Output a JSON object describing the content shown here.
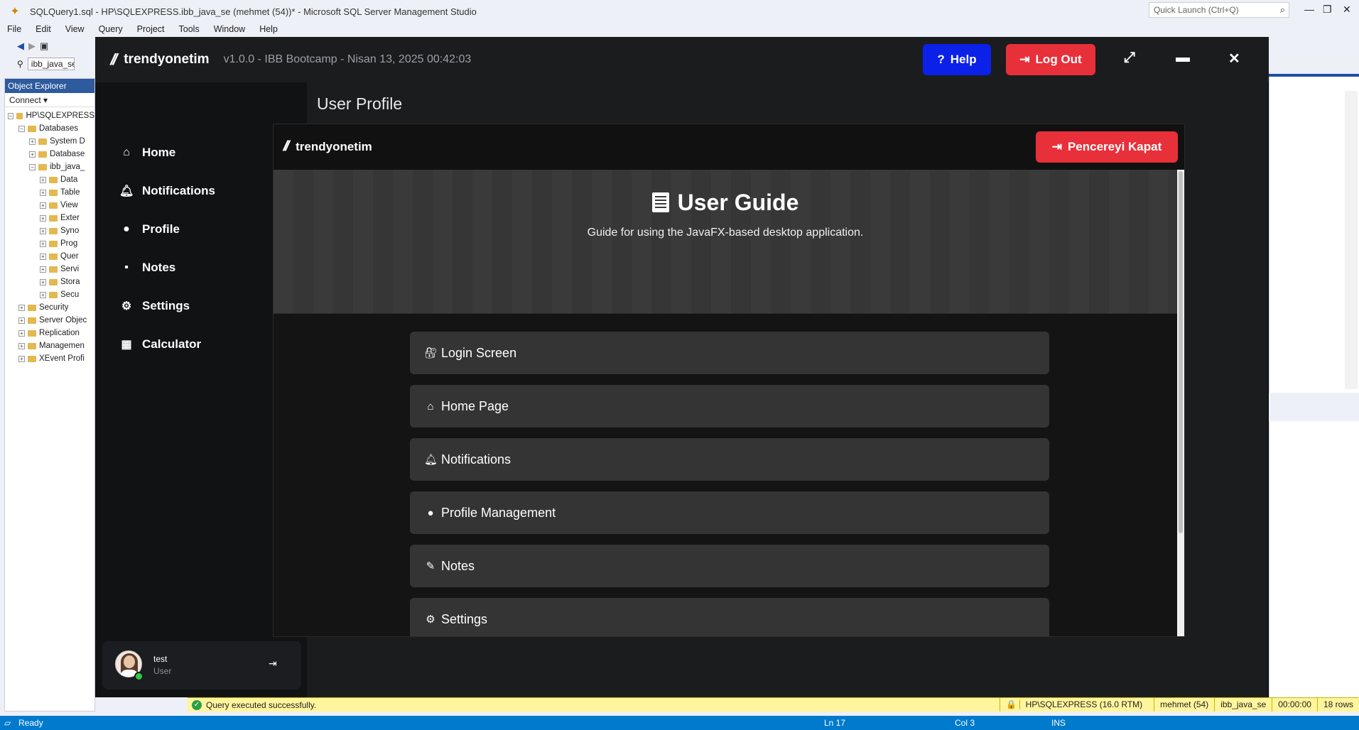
{
  "ssms": {
    "title": "SQLQuery1.sql - HP\\SQLEXPRESS.ibb_java_se (mehmet (54))* - Microsoft SQL Server Management Studio",
    "quick_launch": "Quick Launch (Ctrl+Q)",
    "menu": [
      "File",
      "Edit",
      "View",
      "Query",
      "Project",
      "Tools",
      "Window",
      "Help"
    ],
    "db_combo": "ibb_java_se",
    "object_explorer": {
      "title": "Object Explorer",
      "connect": "Connect ▾",
      "tree": [
        {
          "label": "HP\\SQLEXPRESS",
          "exp": "⊟",
          "indent": 0
        },
        {
          "label": "Databases",
          "exp": "⊟",
          "indent": 1
        },
        {
          "label": "System D",
          "exp": "⊞",
          "indent": 2
        },
        {
          "label": "Database",
          "exp": "⊞",
          "indent": 2
        },
        {
          "label": "ibb_java_",
          "exp": "⊟",
          "indent": 2
        },
        {
          "label": "Data",
          "exp": "⊞",
          "indent": 3
        },
        {
          "label": "Table",
          "exp": "⊞",
          "indent": 3
        },
        {
          "label": "View",
          "exp": "⊞",
          "indent": 3
        },
        {
          "label": "Exter",
          "exp": "⊞",
          "indent": 3
        },
        {
          "label": "Syno",
          "exp": "⊞",
          "indent": 3
        },
        {
          "label": "Prog",
          "exp": "⊞",
          "indent": 3
        },
        {
          "label": "Quer",
          "exp": "⊞",
          "indent": 3
        },
        {
          "label": "Servi",
          "exp": "⊞",
          "indent": 3
        },
        {
          "label": "Stora",
          "exp": "⊞",
          "indent": 3
        },
        {
          "label": "Secu",
          "exp": "⊞",
          "indent": 3
        },
        {
          "label": "Security",
          "exp": "⊞",
          "indent": 1
        },
        {
          "label": "Server Objec",
          "exp": "⊞",
          "indent": 1
        },
        {
          "label": "Replication",
          "exp": "⊞",
          "indent": 1
        },
        {
          "label": "Managemen",
          "exp": "⊞",
          "indent": 1
        },
        {
          "label": "XEvent Profi",
          "exp": "⊞",
          "indent": 1
        }
      ]
    },
    "query_status": {
      "message": "Query executed successfully.",
      "server": "HP\\SQLEXPRESS (16.0 RTM)",
      "user": "mehmet (54)",
      "database": "ibb_java_se",
      "time": "00:00:00",
      "rows": "18 rows"
    },
    "statusbar": {
      "state": "Ready",
      "ln": "Ln 17",
      "col": "Col 3",
      "mode": "INS"
    }
  },
  "app": {
    "brand": "trendyonetim",
    "meta": "v1.0.0 - IBB Bootcamp - Nisan 13, 2025  00:42:03",
    "help_label": "Help",
    "logout_label": "Log Out",
    "nav": [
      {
        "label": "Home",
        "icon": "home-icon"
      },
      {
        "label": "Notifications",
        "icon": "bell-icon"
      },
      {
        "label": "Profile",
        "icon": "user-icon"
      },
      {
        "label": "Notes",
        "icon": "note-icon"
      },
      {
        "label": "Settings",
        "icon": "gear-icon"
      },
      {
        "label": "Calculator",
        "icon": "calculator-icon"
      }
    ],
    "user": {
      "name": "test",
      "role": "User"
    },
    "page_title": "User Profile"
  },
  "guide": {
    "brand": "trendyonetim",
    "close_label": "Pencereyi Kapat",
    "title": "User Guide",
    "subtitle": "Guide for using the JavaFX-based desktop application.",
    "sections": [
      {
        "label": "Login Screen",
        "icon": "lock-key-icon"
      },
      {
        "label": "Home Page",
        "icon": "home-icon"
      },
      {
        "label": "Notifications",
        "icon": "bell-icon"
      },
      {
        "label": "Profile Management",
        "icon": "user-icon"
      },
      {
        "label": "Notes",
        "icon": "memo-icon"
      },
      {
        "label": "Settings",
        "icon": "gear-icon"
      }
    ]
  },
  "colors": {
    "help": "#0b21e8",
    "danger": "#e8303a",
    "status_blue": "#007acc",
    "status_yellow": "#fff59d"
  }
}
